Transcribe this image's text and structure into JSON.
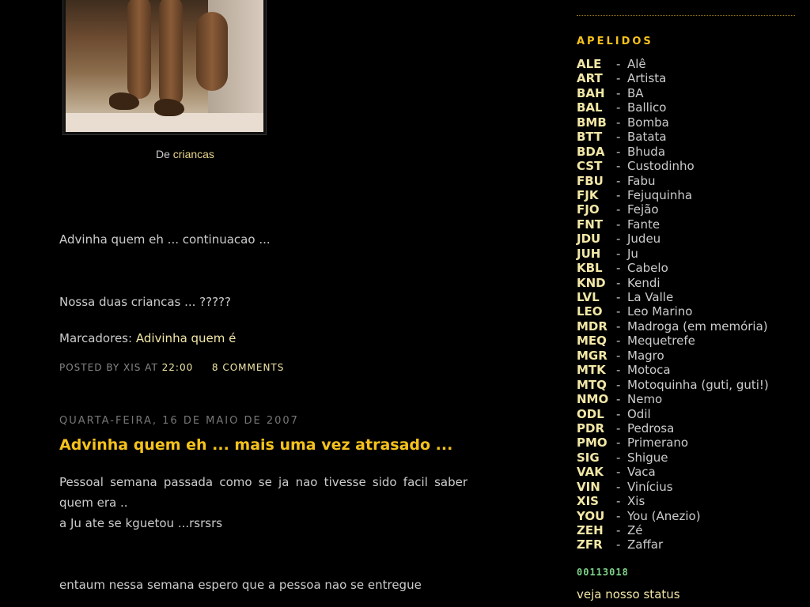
{
  "post1": {
    "caption_prefix": "De",
    "caption_link": "criancas",
    "line1": "Advinha quem eh ... continuacao ...",
    "line2": "Nossa duas criancas ... ?????",
    "labels_prefix": "Marcadores:",
    "label_link": "Adivinha quem é",
    "posted_by": "POSTED BY XIS AT",
    "time": "22:00",
    "comments": "8 COMMENTS"
  },
  "post2": {
    "date_header": "QUARTA-FEIRA, 16 DE MAIO DE 2007",
    "title": "Advinha quem eh ... mais uma vez atrasado ...",
    "body_line1": "Pessoal semana passada como se ja nao tivesse sido facil saber quem era ..",
    "body_line2": "a Ju ate se kguetou ...rsrsrs",
    "body_line3": "entaum nessa semana espero que a pessoa nao se entregue"
  },
  "sidebar": {
    "title": "APELIDOS",
    "items": [
      {
        "code": "ALE",
        "name": "Alê"
      },
      {
        "code": "ART",
        "name": "Artista"
      },
      {
        "code": "BAH",
        "name": "BA"
      },
      {
        "code": "BAL",
        "name": "Ballico"
      },
      {
        "code": "BMB",
        "name": "Bomba"
      },
      {
        "code": "BTT",
        "name": "Batata"
      },
      {
        "code": "BDA",
        "name": "Bhuda"
      },
      {
        "code": "CST",
        "name": "Custodinho"
      },
      {
        "code": "FBU",
        "name": "Fabu"
      },
      {
        "code": "FJK",
        "name": "Fejuquinha"
      },
      {
        "code": "FJO",
        "name": "Fejão"
      },
      {
        "code": "FNT",
        "name": "Fante"
      },
      {
        "code": "JDU",
        "name": "Judeu"
      },
      {
        "code": "JUH",
        "name": "Ju"
      },
      {
        "code": "KBL",
        "name": "Cabelo"
      },
      {
        "code": "KND",
        "name": "Kendi"
      },
      {
        "code": "LVL",
        "name": "La Valle"
      },
      {
        "code": "LEO",
        "name": "Leo Marino"
      },
      {
        "code": "MDR",
        "name": "Madroga (em memória)"
      },
      {
        "code": "MEQ",
        "name": "Mequetrefe"
      },
      {
        "code": "MGR",
        "name": "Magro"
      },
      {
        "code": "MTK",
        "name": "Motoca"
      },
      {
        "code": "MTQ",
        "name": "Motoquinha (guti, guti!)"
      },
      {
        "code": "NMO",
        "name": "Nemo"
      },
      {
        "code": "ODL",
        "name": "Odil"
      },
      {
        "code": "PDR",
        "name": "Pedrosa"
      },
      {
        "code": "PMO",
        "name": "Primerano"
      },
      {
        "code": "SIG",
        "name": "Shigue"
      },
      {
        "code": "VAK",
        "name": "Vaca"
      },
      {
        "code": "VIN",
        "name": "Vinícius"
      },
      {
        "code": "XIS",
        "name": "Xis"
      },
      {
        "code": "YOU",
        "name": "You (Anezio)"
      },
      {
        "code": "ZEH",
        "name": "Zé"
      },
      {
        "code": "ZFR",
        "name": "Zaffar"
      }
    ],
    "separator": "-",
    "counter": "00113018",
    "status_link": "veja nosso status"
  },
  "colors": {
    "accent": "#f5c21c",
    "link": "#f2e7a6",
    "text": "#cccccc",
    "counter": "#7fd48a"
  }
}
